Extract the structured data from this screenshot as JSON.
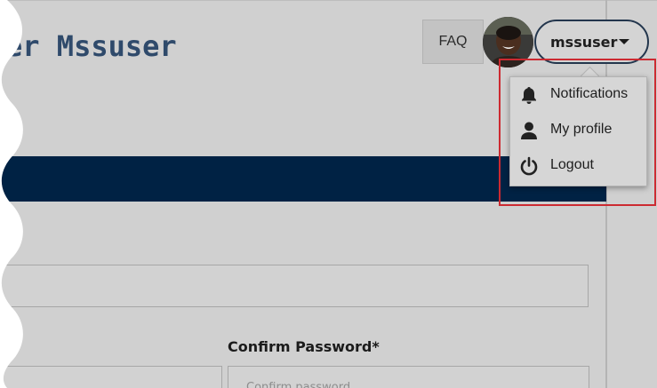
{
  "page": {
    "title": "er Mssuser",
    "banner_color": "#002244",
    "form": {
      "confirm_password_label": "Confirm Password*",
      "confirm_password_placeholder": "Confirm password"
    }
  },
  "header": {
    "faq_label": "FAQ",
    "username": "mssuser",
    "avatar_icon": "user-avatar-photo"
  },
  "user_menu": {
    "items": [
      {
        "label": "Notifications",
        "icon": "bell-icon"
      },
      {
        "label": "My profile",
        "icon": "person-icon"
      },
      {
        "label": "Logout",
        "icon": "power-icon"
      }
    ]
  },
  "colors": {
    "title": "#2f4a6b",
    "highlight": "#cc2a31"
  }
}
